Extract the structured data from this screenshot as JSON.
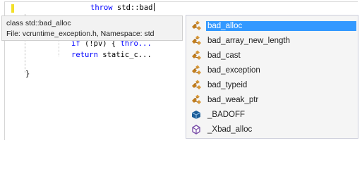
{
  "code": {
    "line1": {
      "keyword": "throw",
      "text": " std::bad"
    },
    "line2": {
      "keyword": "if",
      "text": " (!pv) { ",
      "keyword2": "thro..."
    },
    "line3": {
      "keyword": "return",
      "text": " static_c..."
    },
    "line4": {
      "text": "}"
    }
  },
  "tooltip": {
    "line1": "class std::bad_alloc",
    "line2": "File: vcruntime_exception.h, Namespace: std"
  },
  "completion": {
    "items": [
      {
        "label": "bad_alloc",
        "icon": "class-icon",
        "selected": true
      },
      {
        "label": "bad_array_new_length",
        "icon": "class-icon",
        "selected": false
      },
      {
        "label": "bad_cast",
        "icon": "class-icon",
        "selected": false
      },
      {
        "label": "bad_exception",
        "icon": "class-icon",
        "selected": false
      },
      {
        "label": "bad_typeid",
        "icon": "class-icon",
        "selected": false
      },
      {
        "label": "bad_weak_ptr",
        "icon": "class-icon",
        "selected": false
      },
      {
        "label": "_BADOFF",
        "icon": "constant-icon",
        "selected": false
      },
      {
        "label": "_Xbad_alloc",
        "icon": "method-icon",
        "selected": false
      }
    ],
    "colors": {
      "selection": "#3399ff",
      "class_icon": "#c27d1a",
      "constant_icon": "#1e5f99",
      "method_icon": "#7a4fa8"
    }
  }
}
